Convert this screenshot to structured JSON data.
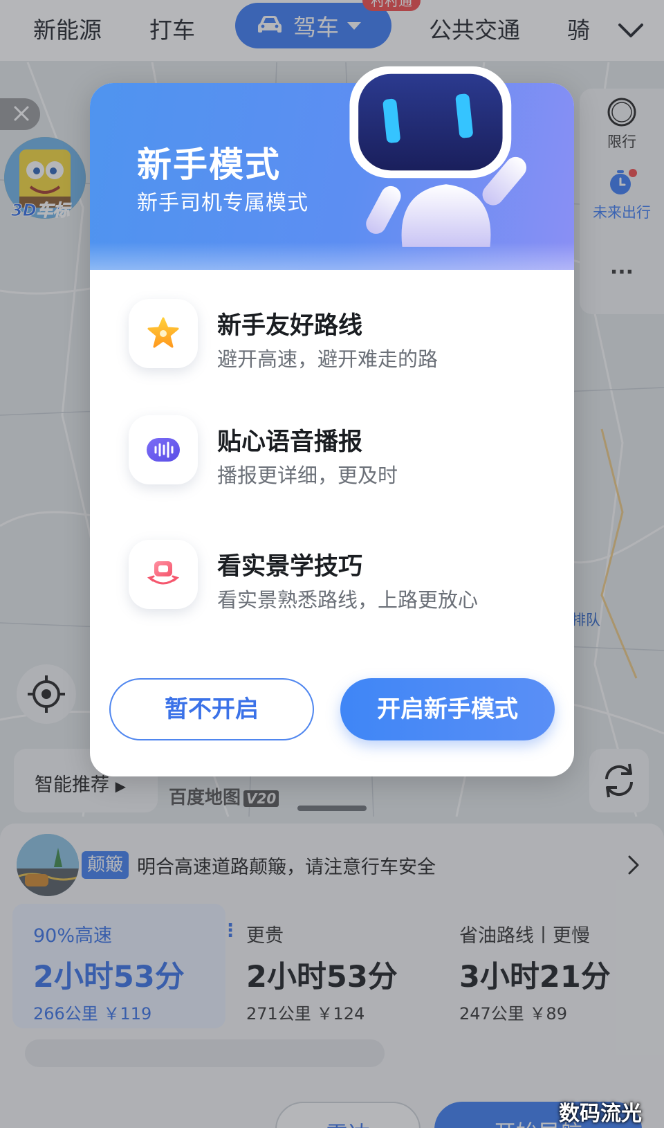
{
  "top_nav": {
    "tabs": [
      "新能源",
      "打车",
      "公共交通",
      "骑"
    ],
    "active_tab": "驾车",
    "active_badge": "村村通"
  },
  "map": {
    "car_label": "3D车标",
    "right_tools": {
      "restrict_icon_text": "限",
      "restrict_label": "限行",
      "future_label": "未来出行",
      "more_label": "···"
    },
    "smart_recommend": "智能推荐",
    "watermark": "百度地图",
    "watermark_version": "V20",
    "queue_note": "排队"
  },
  "modal": {
    "title": "新手模式",
    "subtitle": "新手司机专属模式",
    "features": [
      {
        "title": "新手友好路线",
        "desc": "避开高速，避开难走的路",
        "icon": "star-icon"
      },
      {
        "title": "贴心语音播报",
        "desc": "播报更详细，更及时",
        "icon": "voice-wave-icon"
      },
      {
        "title": "看实景学技巧",
        "desc": "看实景熟悉路线，上路更放心",
        "icon": "live-view-icon"
      }
    ],
    "btn_later": "暂不开启",
    "btn_enable": "开启新手模式"
  },
  "route_sheet": {
    "alert_tag": "颠簸",
    "alert_text": "明合高速道路颠簸，请注意行车安全",
    "routes": [
      {
        "tag": "90%高速",
        "time": "2小时53分",
        "meta": "266公里 ￥119"
      },
      {
        "tag": "更贵",
        "time": "2小时53分",
        "meta": "271公里 ￥124"
      },
      {
        "tag": "省油路线丨更慢",
        "time": "3小时21分",
        "meta": "247公里 ￥89"
      }
    ],
    "btn_left": "雷达",
    "btn_right": "开始导航",
    "btn_right_badge": "",
    "corner_watermark": "数码流光"
  },
  "colors": {
    "accent": "#3b7bf6",
    "badge": "#f2494a",
    "header_start": "#4f94ef",
    "header_end": "#8a8ff4"
  }
}
